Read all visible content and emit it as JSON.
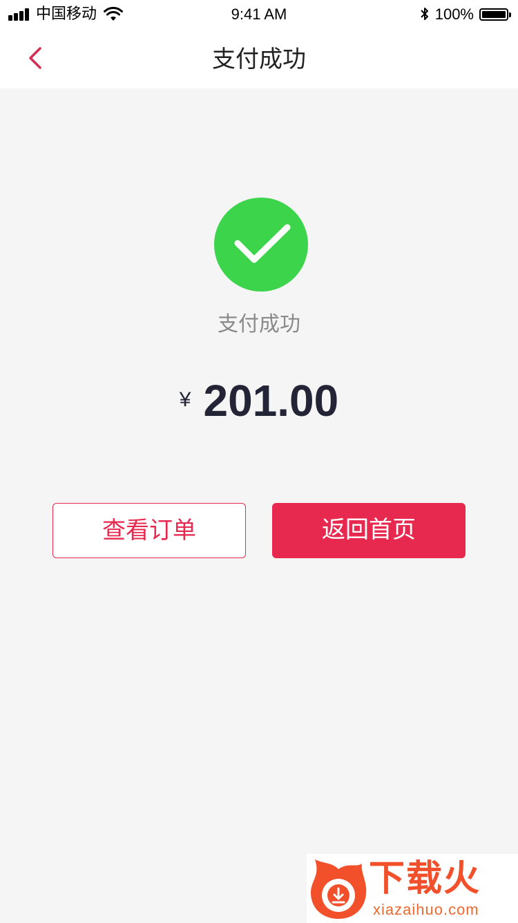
{
  "status_bar": {
    "carrier": "中国移动",
    "time": "9:41 AM",
    "battery": "100%"
  },
  "nav": {
    "title": "支付成功",
    "back_icon": "chevron-left-icon"
  },
  "result": {
    "icon": "checkmark-icon",
    "message": "支付成功",
    "currency": "¥",
    "amount": "201.00"
  },
  "actions": {
    "view_order": "查看订单",
    "back_home": "返回首页"
  },
  "watermark": {
    "title": "下载火",
    "site": "xiazaihuo.com"
  },
  "colors": {
    "accent": "#e8294f",
    "success": "#3bd44b",
    "background": "#f5f5f5",
    "amount_text": "#232536"
  }
}
